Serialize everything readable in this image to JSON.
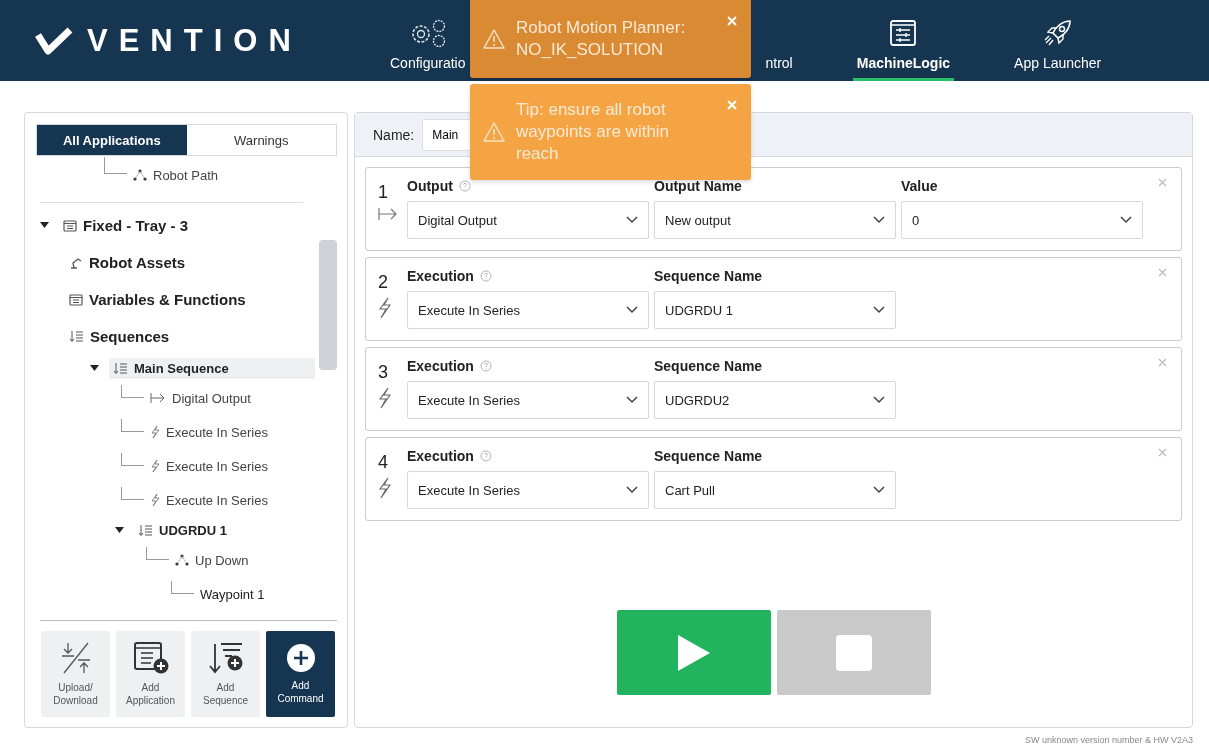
{
  "header": {
    "logo": "VENTION",
    "nav": [
      {
        "label": "Configuratio",
        "kind": "gears",
        "selected": false
      },
      {
        "label": "ntrol",
        "kind": "plain",
        "selected": false
      },
      {
        "label": "MachineLogic",
        "kind": "sliders",
        "selected": true
      },
      {
        "label": "App Launcher",
        "kind": "rocket",
        "selected": false
      }
    ]
  },
  "toasts": [
    {
      "kind": "error",
      "text": "Robot Motion Planner: NO_IK_SOLUTION"
    },
    {
      "kind": "tip",
      "text": "Tip: ensure all robot waypoints are within reach"
    }
  ],
  "sidebar": {
    "tabs": [
      {
        "label": "All Applications",
        "selected": true
      },
      {
        "label": "Warnings",
        "selected": false
      }
    ],
    "tree": [
      {
        "label": "Robot Path",
        "kind": "path",
        "selected": false
      },
      {
        "label": "Fixed - Tray - 3",
        "kind": "application",
        "expanded": true,
        "selected": false,
        "children": [
          {
            "label": "Robot Assets",
            "kind": "assets",
            "selected": false
          },
          {
            "label": "Variables & Functions",
            "kind": "variables",
            "selected": false
          },
          {
            "label": "Sequences",
            "kind": "sequences",
            "selected": false,
            "children": [
              {
                "label": "Main Sequence",
                "kind": "sequence",
                "expanded": true,
                "selected": true,
                "children": [
                  {
                    "label": "Digital Output",
                    "kind": "output",
                    "selected": false
                  },
                  {
                    "label": "Execute In Series",
                    "kind": "execute",
                    "selected": false
                  },
                  {
                    "label": "Execute In Series",
                    "kind": "execute",
                    "selected": false
                  },
                  {
                    "label": "Execute In Series",
                    "kind": "execute",
                    "selected": false
                  },
                  {
                    "label": "UDGRDU 1",
                    "kind": "sequence",
                    "expanded": true,
                    "selected": false,
                    "children": [
                      {
                        "label": "Up Down",
                        "kind": "path",
                        "selected": false,
                        "children": [
                          {
                            "label": "Waypoint 1",
                            "kind": "waypoint",
                            "selected": false
                          }
                        ]
                      }
                    ]
                  }
                ]
              }
            ]
          }
        ]
      }
    ],
    "actions": [
      {
        "label": "Upload/ Download",
        "kind": "transfer",
        "primary": false
      },
      {
        "label": "Add Application",
        "kind": "add-application",
        "primary": false
      },
      {
        "label": "Add Sequence",
        "kind": "add-sequence",
        "primary": false
      },
      {
        "label": "Add Command",
        "kind": "add-command",
        "primary": true
      }
    ]
  },
  "editor": {
    "name_label": "Name:",
    "name_value": "Main",
    "commands": [
      {
        "number": "1",
        "kind": "output",
        "fields": [
          {
            "label": "Output",
            "help": true,
            "value": "Digital Output"
          },
          {
            "label": "Output Name",
            "value": "New output"
          },
          {
            "label": "Value",
            "value": "0"
          }
        ]
      },
      {
        "number": "2",
        "kind": "execute",
        "fields": [
          {
            "label": "Execution",
            "help": true,
            "value": "Execute In Series"
          },
          {
            "label": "Sequence Name",
            "value": "UDGRDU 1"
          }
        ]
      },
      {
        "number": "3",
        "kind": "execute",
        "fields": [
          {
            "label": "Execution",
            "help": true,
            "value": "Execute In Series"
          },
          {
            "label": "Sequence Name",
            "value": "UDGRDU2"
          }
        ]
      },
      {
        "number": "4",
        "kind": "execute",
        "fields": [
          {
            "label": "Execution",
            "help": true,
            "value": "Execute In Series"
          },
          {
            "label": "Sequence Name",
            "value": "Cart Pull"
          }
        ]
      }
    ],
    "run_button": {
      "disabled": false
    },
    "stop_button": {
      "disabled": true
    }
  },
  "footer": "SW unknown version number & HW V2A3"
}
